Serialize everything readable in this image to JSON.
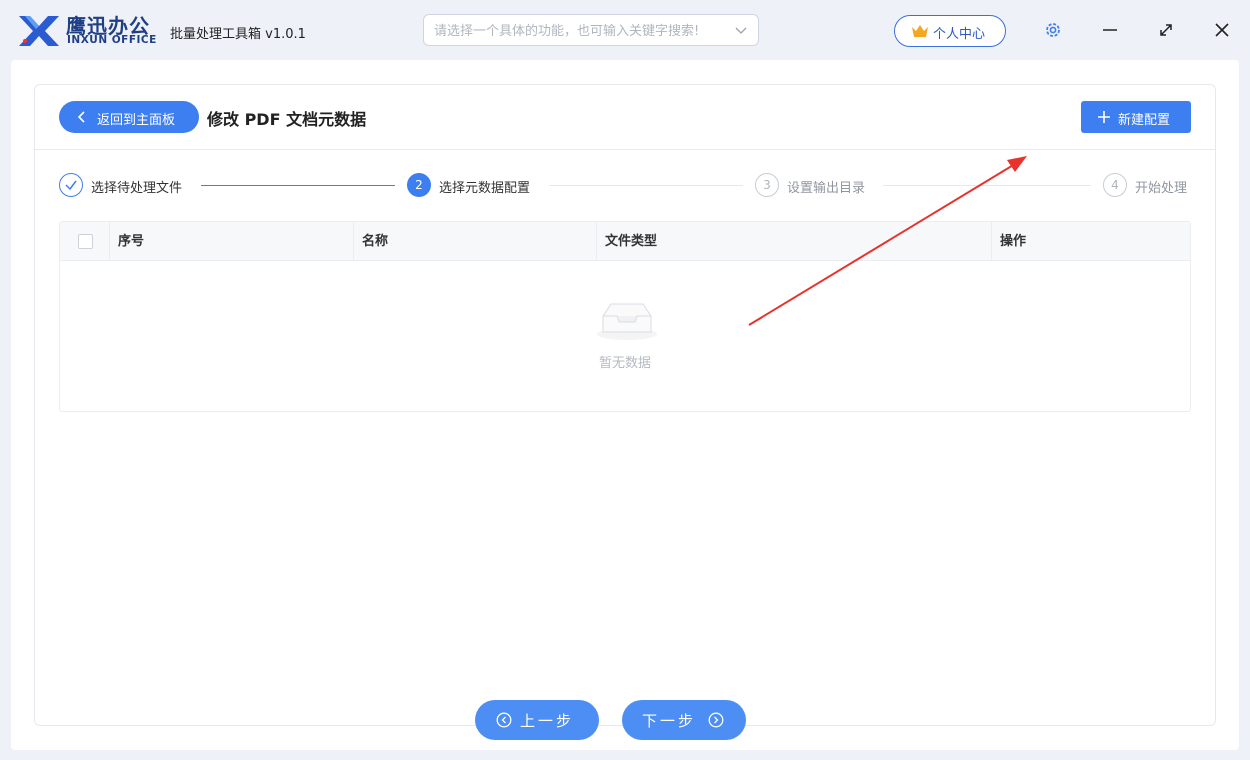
{
  "app": {
    "brand_cn": "鹰迅办公",
    "brand_en": "INXUN OFFICE",
    "title": "批量处理工具箱 v1.0.1"
  },
  "search": {
    "placeholder": "请选择一个具体的功能，也可输入关键字搜索!"
  },
  "header": {
    "user_center_label": "个人中心"
  },
  "colors": {
    "primary": "#3d7ef0",
    "brand_dark_blue": "#1f3f86",
    "annotation_red": "#e8322b"
  },
  "icons": [
    "logo-icon",
    "chevron-down-icon",
    "crown-icon",
    "gear-icon",
    "minimize-icon",
    "maximize-icon",
    "close-icon",
    "chevron-left-icon",
    "plus-icon",
    "check-icon",
    "empty-inbox-icon",
    "circle-left-icon",
    "circle-right-icon"
  ],
  "page": {
    "back_label": "返回到主面板",
    "title": "修改 PDF 文档元数据",
    "new_config_label": "新建配置"
  },
  "steps": [
    {
      "number": "1",
      "label": "选择待处理文件",
      "state": "done"
    },
    {
      "number": "2",
      "label": "选择元数据配置",
      "state": "active"
    },
    {
      "number": "3",
      "label": "设置输出目录",
      "state": "pending"
    },
    {
      "number": "4",
      "label": "开始处理",
      "state": "pending"
    }
  ],
  "table": {
    "columns": [
      "序号",
      "名称",
      "文件类型",
      "操作"
    ],
    "rows": [],
    "empty_text": "暂无数据"
  },
  "footer": {
    "prev_label": "上一步",
    "next_label": "下一步"
  }
}
